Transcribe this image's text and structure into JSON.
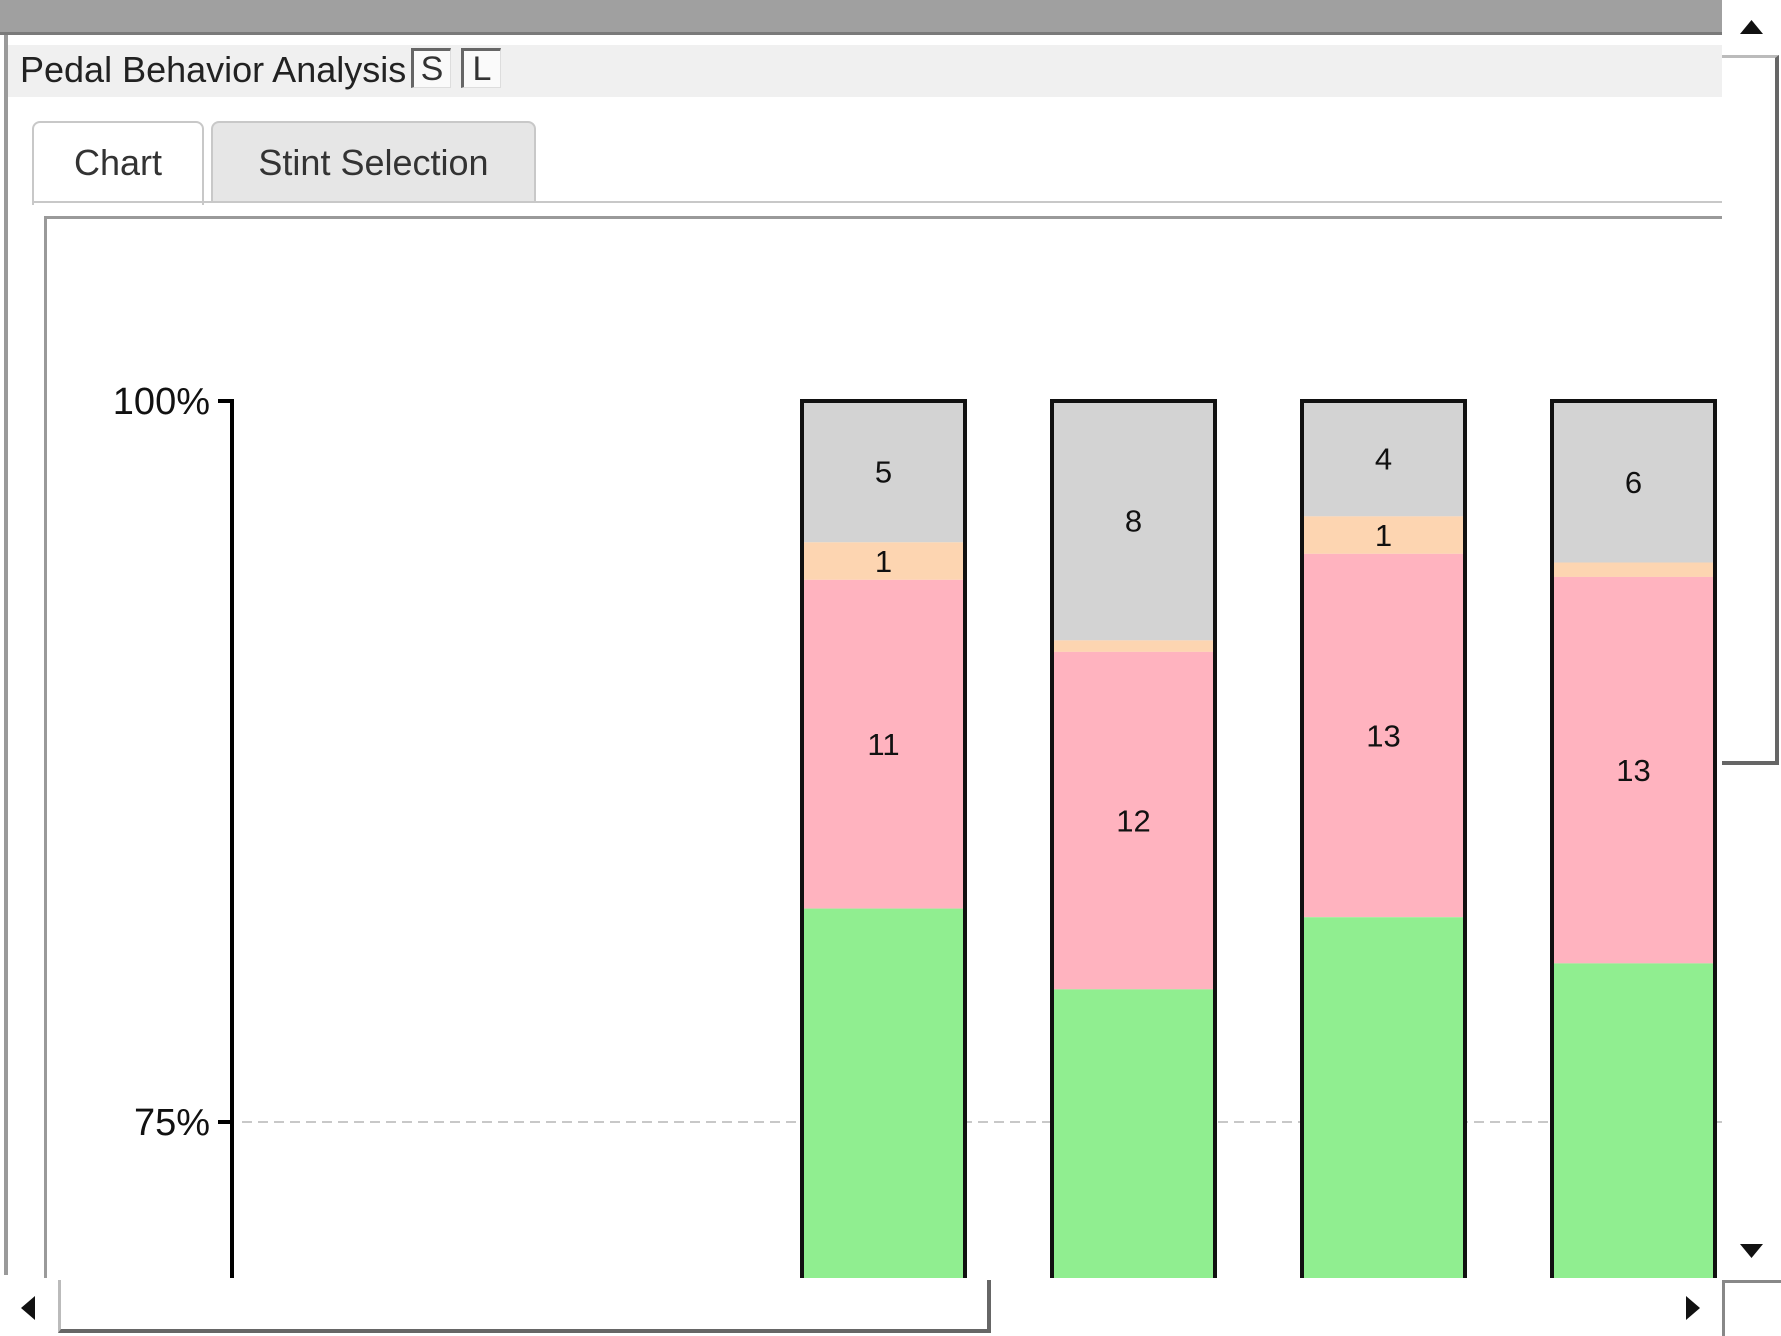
{
  "window": {
    "panel_title": "Pedal Behavior Analysis",
    "button_s": "S",
    "button_l": "L"
  },
  "tabs": [
    {
      "label": "Chart",
      "active": true
    },
    {
      "label": "Stint Selection",
      "active": false
    }
  ],
  "colors": {
    "gray_segment": "#d3d3d3",
    "orange_segment": "#fdd5b1",
    "pink_segment": "#ffb3bf",
    "green_segment": "#90ee90",
    "axis": "#000000",
    "grid": "#c8c8c8"
  },
  "chart_data": {
    "type": "bar",
    "stacked": true,
    "ylim": [
      0,
      100
    ],
    "visible_ylim": [
      70.5,
      100
    ],
    "y_ticks": [
      "75%",
      "100%"
    ],
    "grid": "dashed at 75%",
    "bars": [
      {
        "segments": [
          {
            "color": "gray",
            "value_pct": 4.9,
            "label": "5"
          },
          {
            "color": "orange",
            "value_pct": 1.3,
            "label": "1"
          },
          {
            "color": "pink",
            "value_pct": 11.4,
            "label": "11"
          },
          {
            "color": "green",
            "value_pct": 82.4,
            "label": ""
          }
        ]
      },
      {
        "segments": [
          {
            "color": "gray",
            "value_pct": 8.3,
            "label": "8"
          },
          {
            "color": "orange",
            "value_pct": 0.4,
            "label": ""
          },
          {
            "color": "pink",
            "value_pct": 11.7,
            "label": "12"
          },
          {
            "color": "green",
            "value_pct": 79.6,
            "label": ""
          }
        ]
      },
      {
        "segments": [
          {
            "color": "gray",
            "value_pct": 4.0,
            "label": "4"
          },
          {
            "color": "orange",
            "value_pct": 1.3,
            "label": "1"
          },
          {
            "color": "pink",
            "value_pct": 12.6,
            "label": "13"
          },
          {
            "color": "green",
            "value_pct": 82.1,
            "label": ""
          }
        ]
      },
      {
        "segments": [
          {
            "color": "gray",
            "value_pct": 5.6,
            "label": "6"
          },
          {
            "color": "orange",
            "value_pct": 0.5,
            "label": ""
          },
          {
            "color": "pink",
            "value_pct": 13.4,
            "label": "13"
          },
          {
            "color": "green",
            "value_pct": 80.5,
            "label": ""
          }
        ]
      }
    ]
  }
}
